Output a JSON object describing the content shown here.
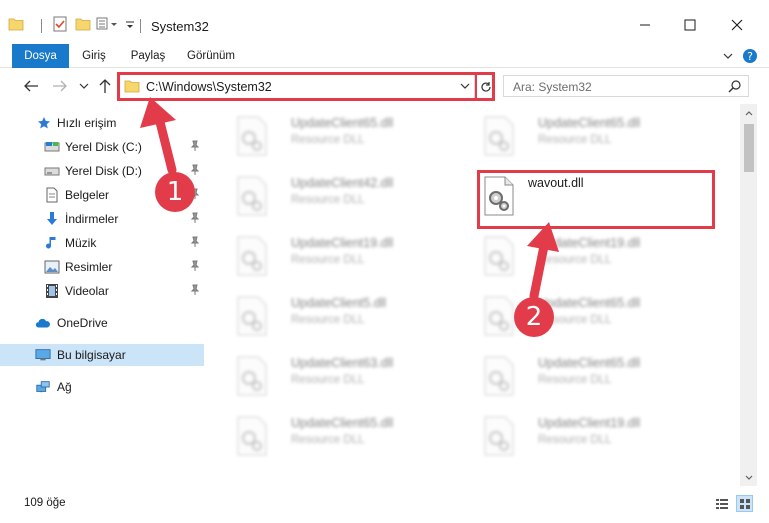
{
  "window": {
    "title": "System32",
    "minimize_icon": "minimize-icon",
    "maximize_icon": "maximize-icon",
    "close_icon": "close-icon"
  },
  "ribbon": {
    "tabs": [
      {
        "label": "Dosya"
      },
      {
        "label": "Giriş"
      },
      {
        "label": "Paylaş"
      },
      {
        "label": "Görünüm"
      }
    ]
  },
  "address": {
    "path": "C:\\Windows\\System32",
    "search_placeholder": "Ara: System32"
  },
  "sidebar": {
    "items": [
      {
        "label": "Hızlı erişim",
        "icon": "star-icon"
      },
      {
        "label": "Yerel Disk (C:)",
        "icon": "drive-icon",
        "pinned": true
      },
      {
        "label": "Yerel Disk (D:)",
        "icon": "drive-icon",
        "pinned": true
      },
      {
        "label": "Belgeler",
        "icon": "documents-icon",
        "pinned": true
      },
      {
        "label": "İndirmeler",
        "icon": "download-icon",
        "pinned": true
      },
      {
        "label": "Müzik",
        "icon": "music-icon",
        "pinned": true
      },
      {
        "label": "Resimler",
        "icon": "pictures-icon",
        "pinned": true
      },
      {
        "label": "Videolar",
        "icon": "videos-icon",
        "pinned": true
      },
      {
        "label": "OneDrive",
        "icon": "cloud-icon"
      },
      {
        "label": "Bu bilgisayar",
        "icon": "computer-icon",
        "selected": true
      },
      {
        "label": "Ağ",
        "icon": "network-icon"
      }
    ]
  },
  "files": {
    "left": [
      {
        "name": "UpdateClient65.dll",
        "type": "Resource DLL"
      },
      {
        "name": "UpdateClient42.dll",
        "type": "Resource DLL"
      },
      {
        "name": "UpdateClient19.dll",
        "type": "Resource DLL"
      },
      {
        "name": "UpdateClient5.dll",
        "type": "Resource DLL"
      },
      {
        "name": "UpdateClient63.dll",
        "type": "Resource DLL"
      },
      {
        "name": "UpdateClient65.dll",
        "type": "Resource DLL"
      }
    ],
    "right": [
      {
        "name": "UpdateClient65.dll",
        "type": "Resource DLL"
      },
      {
        "name": "wavout.dll",
        "type": "",
        "highlighted": true
      },
      {
        "name": "UpdateClient19.dll",
        "type": "Resource DLL"
      },
      {
        "name": "UpdateClient65.dll",
        "type": "Resource DLL"
      },
      {
        "name": "UpdateClient65.dll",
        "type": "Resource DLL"
      },
      {
        "name": "UpdateClient19.dll",
        "type": "Resource DLL"
      }
    ]
  },
  "status": {
    "item_count": "109 öğe"
  },
  "annotations": {
    "step1": "1",
    "step2": "2",
    "color": "#e23c4b"
  },
  "colors": {
    "accent": "#1979ca",
    "selection": "#cce4f7"
  }
}
